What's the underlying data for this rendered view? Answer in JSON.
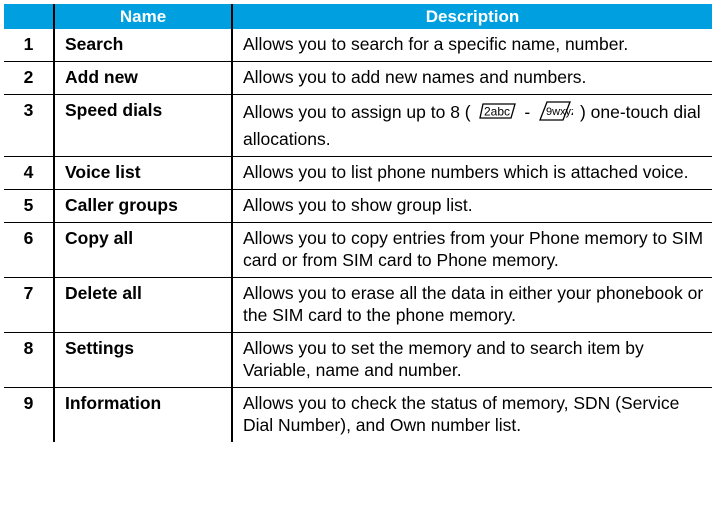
{
  "header": {
    "num": "",
    "name": "Name",
    "description": "Description"
  },
  "rows": [
    {
      "num": "1",
      "name": "Search",
      "desc": "Allows you to search for a specific name, number."
    },
    {
      "num": "2",
      "name": "Add new",
      "desc": "Allows you to add new names and numbers."
    },
    {
      "num": "3",
      "name": "Speed dials",
      "desc_pre": "Allows you to assign up to 8 (",
      "key_2_label": "2abc",
      "dash": "-",
      "key_9_label": "9wxyz",
      "desc_post": ") one-touch dial allocations."
    },
    {
      "num": "4",
      "name": "Voice list",
      "desc": "Allows you to list phone numbers which is attached voice."
    },
    {
      "num": "5",
      "name": "Caller groups",
      "desc": "Allows you to show group list."
    },
    {
      "num": "6",
      "name": "Copy all",
      "desc": "Allows you to copy entries from your Phone memory to SIM card or from SIM card to Phone memory."
    },
    {
      "num": "7",
      "name": "Delete all",
      "desc": "Allows you to erase all the data in either your phonebook or the SIM card to the phone memory."
    },
    {
      "num": "8",
      "name": "Settings",
      "desc": "Allows you to set the memory and to search item by Variable, name and number."
    },
    {
      "num": "9",
      "name": "Information",
      "desc": "Allows you to check the status of memory, SDN (Service Dial Number), and Own number list."
    }
  ],
  "colors": {
    "header_bg": "#00a0e0",
    "header_text": "#ffffff",
    "rule": "#000000"
  },
  "icons": {
    "key_2": "keypad-2-icon",
    "key_9": "keypad-9-icon"
  }
}
